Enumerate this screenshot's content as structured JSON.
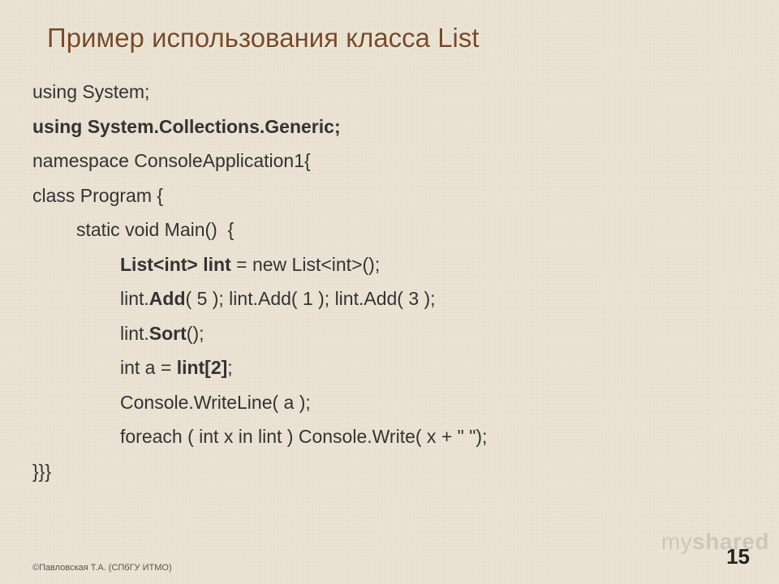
{
  "title": "Пример использования класса List",
  "code": {
    "l1": "using System;",
    "l2": "using System.Collections.Generic;",
    "l3": "namespace ConsoleApplication1{",
    "l4": "class Program {",
    "l5": "static void Main()  {",
    "l6_a": "List",
    "l6_b": "<int>",
    "l6_c": " lint",
    "l6_d": " = new List",
    "l6_e": "<int>",
    "l6_f": "();",
    "l7_a": "lint.",
    "l7_b": "Add",
    "l7_c": "( 5 ); lint.Add( 1 ); lint.Add( 3 );",
    "l8_a": "lint.",
    "l8_b": "Sort",
    "l8_c": "();",
    "l9_a": "int a = ",
    "l9_b": "lint[2]",
    "l9_c": ";",
    "l10": "Console.WriteLine( a );",
    "l11": "foreach ( int x in lint ) Console.Write( x + \" \");",
    "l12": "}}}"
  },
  "footer": "©Павловская Т.А. (СПбГУ ИТМО)",
  "page_number": "15",
  "watermark_a": "my",
  "watermark_b": "shared"
}
